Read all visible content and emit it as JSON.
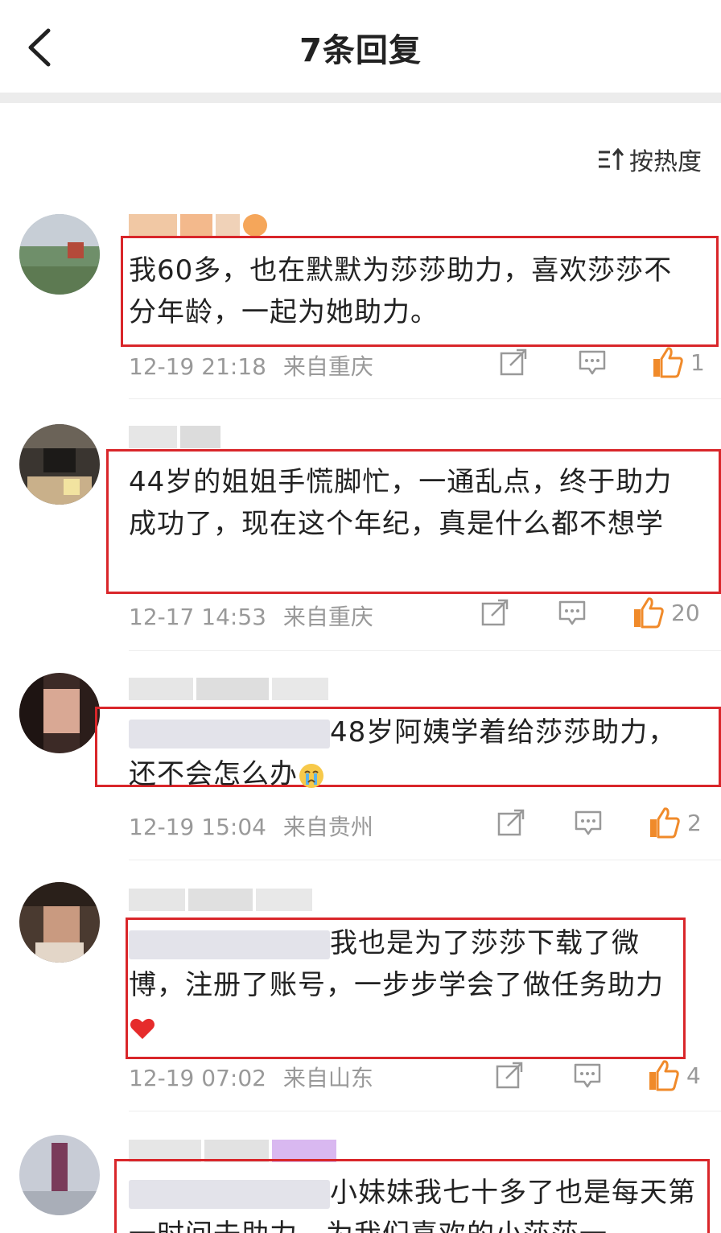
{
  "header": {
    "title": "7条回复"
  },
  "sort": {
    "label": "按热度"
  },
  "comments": [
    {
      "text": "我60多，也在默默为莎莎助力，喜欢莎莎不分年龄，一起为她助力。",
      "time": "12-19 21:18",
      "source": "来自重庆",
      "likes": "1"
    },
    {
      "text": "44岁的姐姐手慌脚忙，一通乱点，终于助力成功了，现在这个年纪，真是什么都不想学",
      "time": "12-17 14:53",
      "source": "来自重庆",
      "likes": "20"
    },
    {
      "text": "48岁阿姨学着给莎莎助力，还不会怎么办",
      "time": "12-19 15:04",
      "source": "来自贵州",
      "likes": "2"
    },
    {
      "text": "我也是为了莎莎下载了微博，注册了账号，一步步学会了做任务助力",
      "time": "12-19 07:02",
      "source": "来自山东",
      "likes": "4"
    },
    {
      "text": "小妹妹我七十多了也是每天第一时间去助力，为我们喜欢的小莎莎一"
    }
  ],
  "colors": {
    "highlight_box": "#d9262a",
    "like_active": "#f08a2a",
    "meta": "#999999"
  },
  "icons": {
    "back": "chevron-left-icon",
    "sort": "sort-icon",
    "share": "share-icon",
    "comment": "comment-icon",
    "like": "thumbs-up-icon",
    "crying": "crying-face-emoji",
    "heart": "heart-emoji"
  }
}
